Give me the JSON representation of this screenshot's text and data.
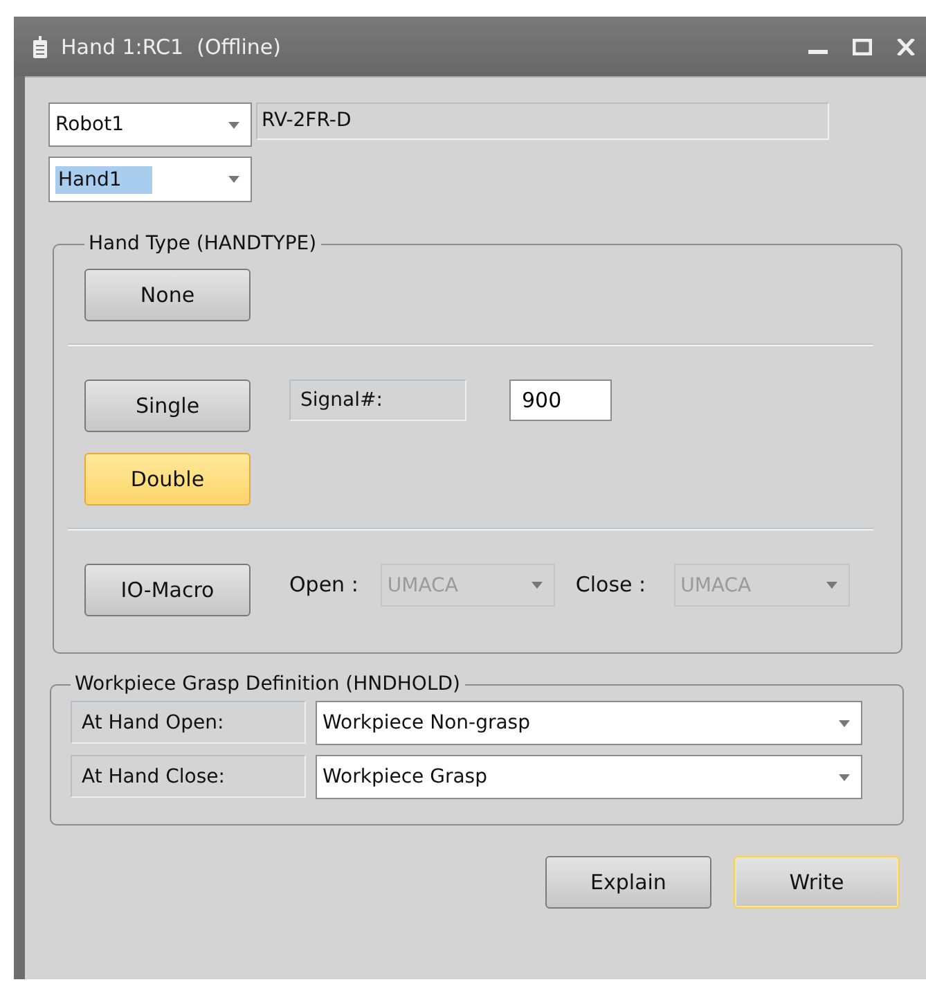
{
  "window": {
    "title": "Hand 1:RC1  (Offline)"
  },
  "robot_select": {
    "value": "Robot1"
  },
  "model": {
    "value": "RV-2FR-D"
  },
  "hand_select": {
    "value": "Hand1",
    "text_highlighted": true
  },
  "hand_type": {
    "title": "Hand Type (HANDTYPE)",
    "options": [
      {
        "label": "None",
        "selected": false,
        "kind": "plain"
      },
      {
        "label": "Single",
        "selected": false,
        "kind": "signal"
      },
      {
        "label": "Double",
        "selected": true,
        "kind": "plain"
      },
      {
        "label": "IO-Macro",
        "selected": false,
        "kind": "macro"
      }
    ],
    "signal": {
      "label": "Signal#:",
      "value": "900"
    },
    "macro": {
      "open_label": "Open :",
      "open_value": "UMACA",
      "close_label": "Close :",
      "close_value": "UMACA",
      "disabled": true
    }
  },
  "grasp": {
    "title": "Workpiece Grasp Definition (HNDHOLD)",
    "rows": [
      {
        "label": "At Hand Open:",
        "value": "Workpiece Non-grasp"
      },
      {
        "label": "At Hand Close:",
        "value": "Workpiece Grasp"
      }
    ]
  },
  "buttons": [
    {
      "label": "Explain",
      "focused": false
    },
    {
      "label": "Write",
      "focused": true
    }
  ]
}
